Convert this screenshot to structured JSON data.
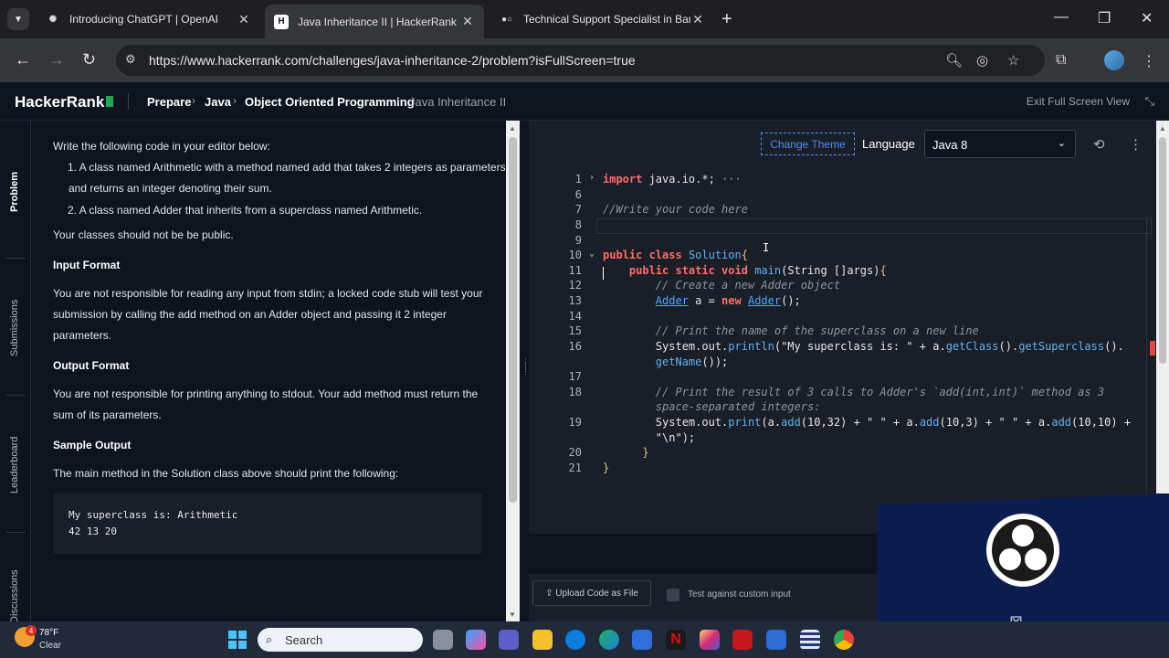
{
  "browser": {
    "tabs": [
      {
        "title": "Introducing ChatGPT | OpenAI",
        "active": false
      },
      {
        "title": "Java Inheritance II | HackerRank",
        "active": true
      },
      {
        "title": "Technical Support Specialist in Bangal",
        "active": false
      }
    ],
    "url": "https://www.hackerrank.com/challenges/java-inheritance-2/problem?isFullScreen=true"
  },
  "header": {
    "logo": "HackerRank",
    "breadcrumbs": [
      "Prepare",
      "Java",
      "Object Oriented Programming",
      "Java Inheritance II"
    ],
    "exit_fullscreen": "Exit Full Screen View"
  },
  "rail": {
    "tabs": [
      "Problem",
      "Submissions",
      "Leaderboard",
      "Discussions"
    ]
  },
  "problem": {
    "intro": "Write the following code in your editor below:",
    "item1_line1": "1. A class named Arithmetic with a method named add that takes 2 integers as parameters",
    "item1_line2": "and returns an integer denoting their sum.",
    "item2": "2. A class named Adder that inherits from a superclass named Arithmetic.",
    "public_note": "Your classes should not be be public.",
    "input_format_title": "Input Format",
    "input_format_l1": "You are not responsible for reading any input from stdin; a locked code stub will test your",
    "input_format_l2": "submission by calling the add method on an Adder object and passing it 2 integer",
    "input_format_l3": "parameters.",
    "output_format_title": "Output Format",
    "output_format_l1": "You are not responsible for printing anything to stdout. Your add method must return the",
    "output_format_l2": "sum of its parameters.",
    "sample_output_title": "Sample Output",
    "sample_output_desc": "The main method in the Solution class above should print the following:",
    "sample_line1": "My superclass is: Arithmetic",
    "sample_line2": "42 13 20"
  },
  "editor": {
    "change_theme": "Change Theme",
    "language_label": "Language",
    "language_value": "Java 8",
    "upload_label": "Upload Code as File",
    "custom_input_label": "Test against custom input",
    "line_numbers": [
      "1",
      "6",
      "7",
      "8",
      "9",
      "10",
      "11",
      "12",
      "13",
      "14",
      "15",
      "16",
      "",
      "17",
      "18",
      "",
      "19",
      "",
      "20",
      "21"
    ]
  },
  "taskbar": {
    "weather_temp": "78°F",
    "weather_cond": "Clear",
    "weather_alert": "4",
    "search_placeholder": "Search"
  },
  "colors": {
    "hr_bg": "#0e141e",
    "hr_green": "#1ba94c",
    "editor_bg": "#1a1f27",
    "keyword": "#ff6b6b",
    "link_blue": "#4c8cff"
  }
}
